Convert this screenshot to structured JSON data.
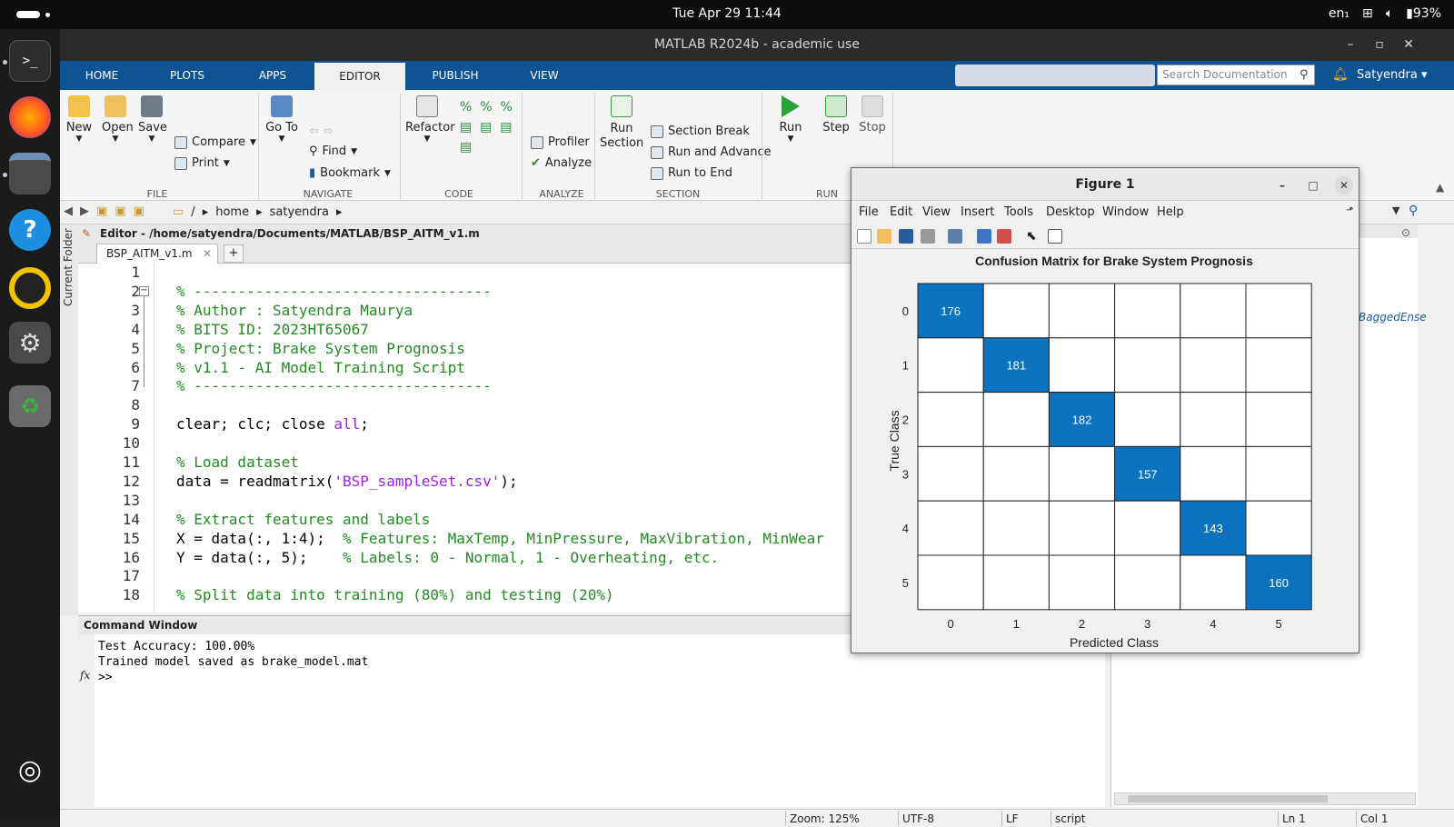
{
  "system": {
    "clock": "Tue Apr 29  11:44",
    "lang": "en₁",
    "battery": "93%"
  },
  "dock": [
    "terminal-icon",
    "firefox-icon",
    "files-icon",
    "help-icon",
    "rhythmbox-icon",
    "settings-icon",
    "trash-icon",
    "apps-icon"
  ],
  "window": {
    "title": "MATLAB R2024b - academic use"
  },
  "tabs": [
    "HOME",
    "PLOTS",
    "APPS",
    "EDITOR",
    "PUBLISH",
    "VIEW"
  ],
  "search": {
    "placeholder": "Search Documentation"
  },
  "user": "Satyendra",
  "toolstrip": {
    "file": {
      "new": "New",
      "open": "Open",
      "save": "Save",
      "compare": "Compare",
      "print": "Print",
      "group": "FILE"
    },
    "navigate": {
      "goto": "Go To",
      "find": "Find",
      "bookmark": "Bookmark",
      "group": "NAVIGATE"
    },
    "code": {
      "refactor": "Refactor",
      "group": "CODE"
    },
    "analyze": {
      "profiler": "Profiler",
      "analyze": "Analyze",
      "group": "ANALYZE"
    },
    "section": {
      "run_section": "Run Section",
      "section_break": "Section Break",
      "run_advance": "Run and Advance",
      "run_end": "Run to End",
      "group": "SECTION"
    },
    "run": {
      "run": "Run",
      "step": "Step",
      "stop": "Stop",
      "group": "RUN"
    }
  },
  "address": {
    "root": "/",
    "p1": "home",
    "p2": "satyendra"
  },
  "side_panel": "Current Folder",
  "editor": {
    "path": "Editor - /home/satyendra/Documents/MATLAB/BSP_AITM_v1.m",
    "tab": "BSP_AITM_v1.m",
    "lines": [
      {
        "n": "1",
        "parts": []
      },
      {
        "n": "2",
        "parts": [
          {
            "t": "% ----------------------------------",
            "c": "cm"
          }
        ]
      },
      {
        "n": "3",
        "parts": [
          {
            "t": "% Author : Satyendra Maurya",
            "c": "cm"
          }
        ]
      },
      {
        "n": "4",
        "parts": [
          {
            "t": "% BITS ID: 2023HT65067",
            "c": "cm"
          }
        ]
      },
      {
        "n": "5",
        "parts": [
          {
            "t": "% Project: Brake System Prognosis",
            "c": "cm"
          }
        ]
      },
      {
        "n": "6",
        "parts": [
          {
            "t": "% v1.1 - AI Model Training Script",
            "c": "cm"
          }
        ]
      },
      {
        "n": "7",
        "parts": [
          {
            "t": "% ----------------------------------",
            "c": "cm"
          }
        ]
      },
      {
        "n": "8",
        "parts": []
      },
      {
        "n": "9",
        "parts": [
          {
            "t": "clear; clc; close ",
            "c": ""
          },
          {
            "t": "all",
            "c": "st"
          },
          {
            "t": ";",
            "c": ""
          }
        ]
      },
      {
        "n": "10",
        "parts": []
      },
      {
        "n": "11",
        "parts": [
          {
            "t": "% Load dataset",
            "c": "cm"
          }
        ]
      },
      {
        "n": "12",
        "parts": [
          {
            "t": "data = readmatrix(",
            "c": ""
          },
          {
            "t": "'BSP_sampleSet.csv'",
            "c": "st"
          },
          {
            "t": ");",
            "c": ""
          }
        ]
      },
      {
        "n": "13",
        "parts": []
      },
      {
        "n": "14",
        "parts": [
          {
            "t": "% Extract features and labels",
            "c": "cm"
          }
        ]
      },
      {
        "n": "15",
        "parts": [
          {
            "t": "X = data(:, 1:4);  ",
            "c": ""
          },
          {
            "t": "% Features: MaxTemp, MinPressure, MaxVibration, MinWear",
            "c": "cm"
          }
        ]
      },
      {
        "n": "16",
        "parts": [
          {
            "t": "Y = data(:, 5);    ",
            "c": ""
          },
          {
            "t": "% Labels: 0 - Normal, 1 - Overheating, etc.",
            "c": "cm"
          }
        ]
      },
      {
        "n": "17",
        "parts": []
      },
      {
        "n": "18",
        "parts": [
          {
            "t": "% Split data into training (80%) and testing (20%)",
            "c": "cm"
          }
        ]
      }
    ]
  },
  "command": {
    "title": "Command Window",
    "lines": [
      "Test Accuracy: 100.00%",
      "Trained model saved as brake_model.mat"
    ],
    "prompt": ">>",
    "fx": "fx"
  },
  "workspace": {
    "partial_text": "BaggedEnse"
  },
  "status": {
    "zoom": "Zoom: 125%",
    "enc": "UTF-8",
    "eol": "LF",
    "type": "script",
    "ln": "Ln  1",
    "col": "Col  1"
  },
  "figure": {
    "title": "Figure 1",
    "menu": [
      "File",
      "Edit",
      "View",
      "Insert",
      "Tools",
      "Desktop",
      "Window",
      "Help"
    ]
  },
  "chart_data": {
    "type": "heatmap",
    "title": "Confusion Matrix for Brake System Prognosis",
    "xlabel": "Predicted Class",
    "ylabel": "True Class",
    "x_categories": [
      "0",
      "1",
      "2",
      "3",
      "4",
      "5"
    ],
    "y_categories": [
      "0",
      "1",
      "2",
      "3",
      "4",
      "5"
    ],
    "matrix": [
      [
        176,
        0,
        0,
        0,
        0,
        0
      ],
      [
        0,
        181,
        0,
        0,
        0,
        0
      ],
      [
        0,
        0,
        182,
        0,
        0,
        0
      ],
      [
        0,
        0,
        0,
        157,
        0,
        0
      ],
      [
        0,
        0,
        0,
        0,
        143,
        0
      ],
      [
        0,
        0,
        0,
        0,
        0,
        160
      ]
    ],
    "colors": {
      "nonzero": "#0a72be",
      "zero": "#ffffff",
      "nonzero_text": "#ffffff"
    }
  }
}
